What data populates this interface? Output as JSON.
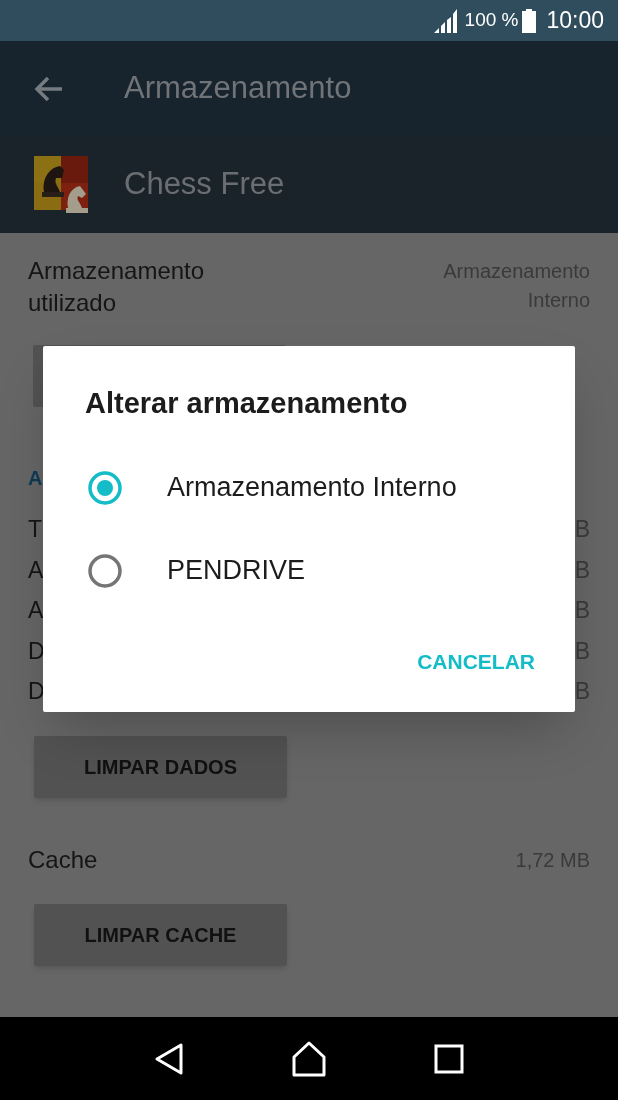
{
  "status_bar": {
    "battery": "100 %",
    "time": "10:00"
  },
  "toolbar": {
    "title": "Armazenamento"
  },
  "app": {
    "name": "Chess Free"
  },
  "storage_used": {
    "label": "Armazenamento utilizado",
    "value": "Armazenamento Interno"
  },
  "section_header": "A",
  "rows": [
    {
      "label": "T",
      "value": "B"
    },
    {
      "label": "A",
      "value": "B"
    },
    {
      "label": "A",
      "value": "B"
    },
    {
      "label": "D",
      "value": "B"
    },
    {
      "label": "D",
      "value": "B"
    }
  ],
  "clear_data_button": "LIMPAR DADOS",
  "cache": {
    "label": "Cache",
    "value": "1,72 MB"
  },
  "clear_cache_button": "LIMPAR CACHE",
  "dialog": {
    "title": "Alterar armazenamento",
    "options": [
      {
        "label": "Armazenamento Interno",
        "selected": true
      },
      {
        "label": "PENDRIVE",
        "selected": false
      }
    ],
    "cancel": "CANCELAR"
  }
}
